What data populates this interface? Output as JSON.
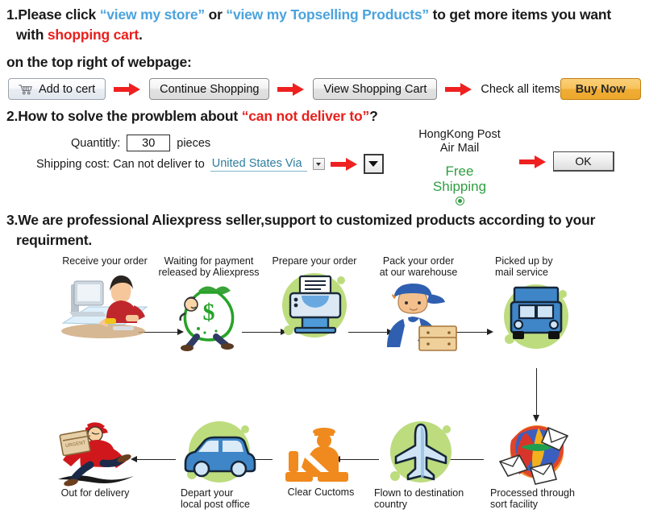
{
  "section1": {
    "line1_pre": "1.Please click ",
    "link1": "“view my store”",
    "line1_mid": " or ",
    "link2": "“view my Topselling Products”",
    "line1_post": " to get more items you want",
    "line2_pre": "with ",
    "line2_red": "shopping cart",
    "line2_post": ".",
    "subline": "on the top right of webpage:",
    "buttons": {
      "add_to_cart": "Add to cert",
      "continue_shopping": "Continue Shopping",
      "view_shopping_cart": "View Shopping Cart",
      "check_all_items": "Check all items",
      "buy_now": "Buy Now"
    },
    "icons": {
      "cart": "shopping-cart-icon",
      "arrow": "red-arrow-icon"
    }
  },
  "section2": {
    "heading_pre": "2.How to solve the prowblem about ",
    "heading_red": "“can not deliver to”",
    "heading_post": "?",
    "quantity_label": "Quantitly:",
    "quantity_value": "30",
    "pieces_label": "pieces",
    "shipping_label": "Shipping cost: Can not deliver to",
    "country_value": "United States Via",
    "carrier_line1": "HongKong Post",
    "carrier_line2": "Air Mail",
    "free_line1": "Free",
    "free_line2": "Shipping",
    "ok_label": "OK"
  },
  "section3": {
    "heading_line1": "3.We are professional Aliexpress seller,support to customized products according to your",
    "heading_line2": "requirment.",
    "steps": [
      {
        "id": "receive-your-order",
        "label": "Receive your order",
        "icon": "person-at-computer-icon"
      },
      {
        "id": "waiting-for-payment",
        "label": "Waiting for payment\nreleased by Aliexpress",
        "icon": "money-bag-icon"
      },
      {
        "id": "prepare-your-order",
        "label": "Prepare your order",
        "icon": "printer-icon"
      },
      {
        "id": "pack-your-order",
        "label": "Pack your order\nat our warehouse",
        "icon": "warehouse-worker-icon"
      },
      {
        "id": "picked-up-by-mail",
        "label": "Picked up by\nmail service",
        "icon": "mail-truck-icon"
      },
      {
        "id": "processed-through-sort",
        "label": "Processed through\nsort facility",
        "icon": "mail-sorting-globe-icon"
      },
      {
        "id": "flown-to-destination",
        "label": "Flown to destination\ncountry",
        "icon": "airplane-icon"
      },
      {
        "id": "clear-customs",
        "label": "Clear Cuctoms",
        "icon": "customs-officer-icon"
      },
      {
        "id": "depart-local-post-office",
        "label": "Depart your\nlocal post office",
        "icon": "delivery-van-icon"
      },
      {
        "id": "out-for-delivery",
        "label": "Out for delivery",
        "icon": "running-courier-icon"
      }
    ]
  },
  "colors": {
    "link_blue": "#4ba3dd",
    "alert_red": "#e8201c",
    "free_green": "#2f9e41",
    "node_green": "#bddc7e",
    "buy_now_orange": "#f0ad35",
    "customs_orange": "#f08a1e"
  }
}
